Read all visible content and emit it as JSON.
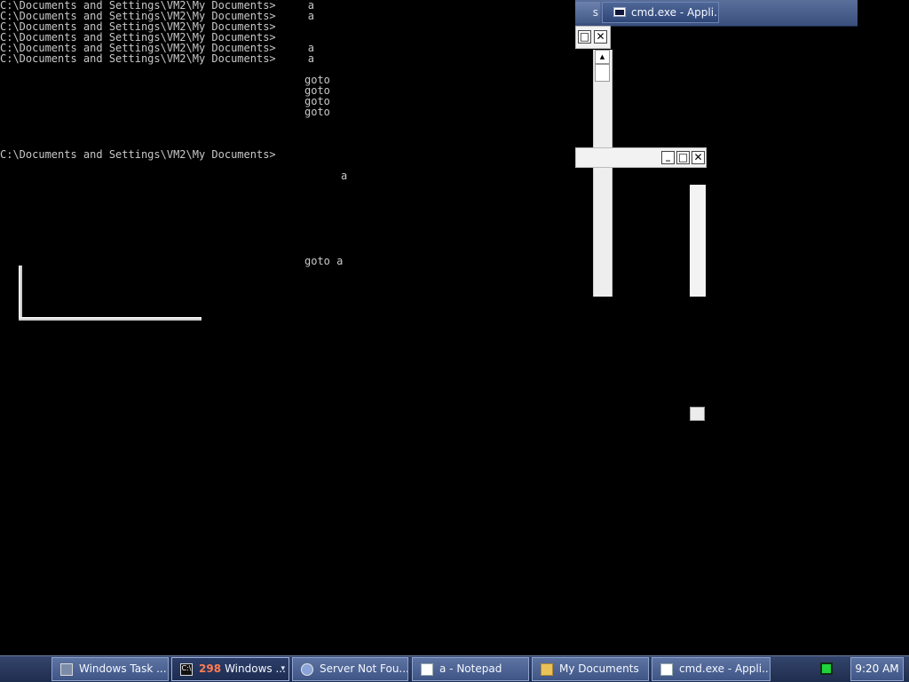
{
  "console": {
    "lines": [
      "C:\\Documents and Settings\\VM2\\My Documents>     a",
      "C:\\Documents and Settings\\VM2\\My Documents>     a",
      "C:\\Documents and Settings\\VM2\\My Documents>",
      "C:\\Documents and Settings\\VM2\\My Documents>",
      "C:\\Documents and Settings\\VM2\\My Documents>     a",
      "C:\\Documents and Settings\\VM2\\My Documents>     a"
    ],
    "goto_lines": [
      "goto",
      "goto",
      "goto",
      "goto"
    ],
    "prompt_line": "C:\\Documents and Settings\\VM2\\My Documents>",
    "a_line": "a",
    "goto_a_line": "goto a"
  },
  "top_taskbar": {
    "cut_text": "s",
    "button_label": "cmd.exe - Appli..."
  },
  "taskbar": {
    "buttons": [
      {
        "label": "Windows Task ...",
        "icon": "task-manager-icon"
      },
      {
        "label": "Windows ...",
        "badge": "298",
        "icon": "cmd-icon"
      },
      {
        "label": "Server Not Fou...",
        "icon": "internet-explorer-icon"
      },
      {
        "label": "a - Notepad",
        "icon": "notepad-icon"
      },
      {
        "label": "My Documents",
        "icon": "folder-icon"
      },
      {
        "label": "cmd.exe - Appli...",
        "icon": "cmd-icon"
      }
    ],
    "cmd_icon_text": "C:\\",
    "tray_icon": "network-activity-icon",
    "clock": "9:20 AM"
  },
  "window_controls": {
    "minimize": "_",
    "maximize": "□",
    "close": "✕",
    "scroll_up": "▲"
  }
}
